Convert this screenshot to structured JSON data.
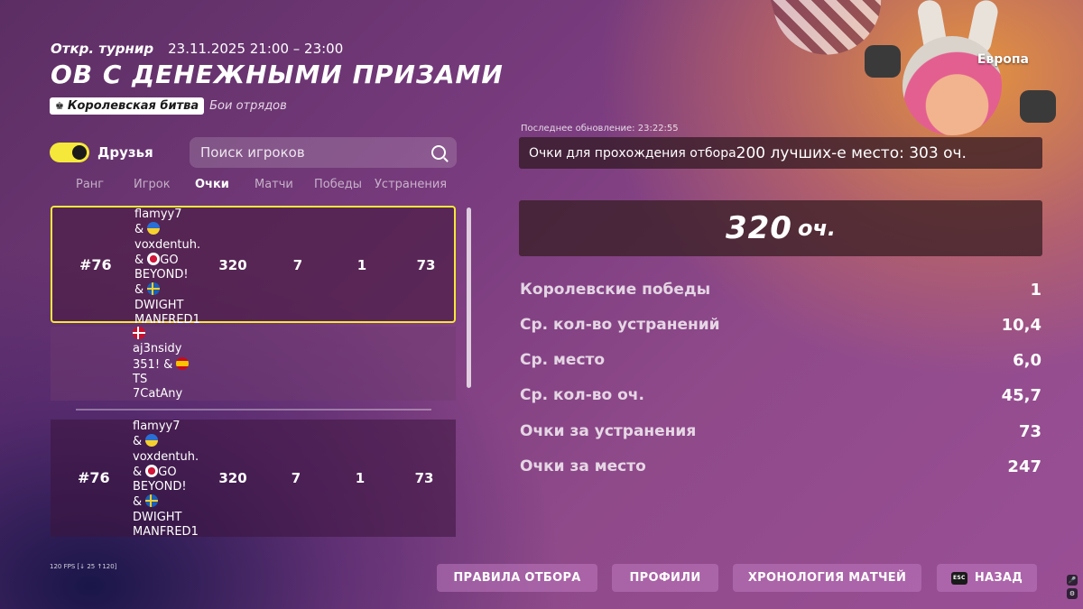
{
  "header": {
    "tournament_type": "Откр. турнир",
    "datetime": "23.11.2025 21:00 – 23:00",
    "title": "ОВ С ДЕНЕЖНЫМИ ПРИЗАМИ",
    "mode": "Королевская битва",
    "submode": "Бои отрядов",
    "region": "Европа"
  },
  "friends_toggle": {
    "label": "Друзья",
    "on": true
  },
  "search": {
    "placeholder": "Поиск игроков"
  },
  "columns": [
    "Ранг",
    "Игрок",
    "Очки",
    "Матчи",
    "Победы",
    "Устранения"
  ],
  "rows": [
    {
      "rank": "#76",
      "players": [
        {
          "name": "flamyy7",
          "flag": "ua"
        },
        {
          "name": "voxdentuh.",
          "flag": "jp"
        },
        {
          "name": "GO BEYOND!",
          "flag": "se"
        },
        {
          "name": "DWIGHT MANFRED1",
          "flag": ""
        }
      ],
      "points": "320",
      "matches": "7",
      "wins": "1",
      "elims": "73"
    },
    {
      "rank": "",
      "players": [
        {
          "name": "aj3nsidy",
          "flag": "dk"
        },
        {
          "name": "351!",
          "flag": "es"
        },
        {
          "name": "TS 7CatAny",
          "flag": ""
        }
      ],
      "points": "",
      "matches": "",
      "wins": "",
      "elims": ""
    },
    {
      "rank": "#76",
      "players": [
        {
          "name": "flamyy7",
          "flag": "ua"
        },
        {
          "name": "voxdentuh.",
          "flag": "jp"
        },
        {
          "name": "GO BEYOND!",
          "flag": "se"
        },
        {
          "name": "DWIGHT MANFRED1",
          "flag": ""
        }
      ],
      "points": "320",
      "matches": "7",
      "wins": "1",
      "elims": "73"
    }
  ],
  "details": {
    "last_update": "Последнее обновление: 23:22:55",
    "qualify_text_a": "Очки для прохождения отбора",
    "qualify_text_b": "200 лучших-е место: 303 оч.",
    "score": "320",
    "score_unit": "оч.",
    "stats": [
      {
        "label": "Королевские победы",
        "value": "1"
      },
      {
        "label": "Ср. кол-во устранений",
        "value": "10,4"
      },
      {
        "label": "Ср. место",
        "value": "6,0"
      },
      {
        "label": "Ср. кол-во оч.",
        "value": "45,7"
      },
      {
        "label": "Очки за устранения",
        "value": "73"
      },
      {
        "label": "Очки за место",
        "value": "247"
      }
    ]
  },
  "fps": "120 FPS [↓ 25 ↑120]",
  "buttons": {
    "rules": "ПРАВИЛА ОТБОРА",
    "profiles": "ПРОФИЛИ",
    "history": "ХРОНОЛОГИЯ МАТЧЕЙ",
    "esc_key": "ESC",
    "back": "НАЗАД"
  },
  "colors": {
    "accent": "#f5e83a"
  }
}
